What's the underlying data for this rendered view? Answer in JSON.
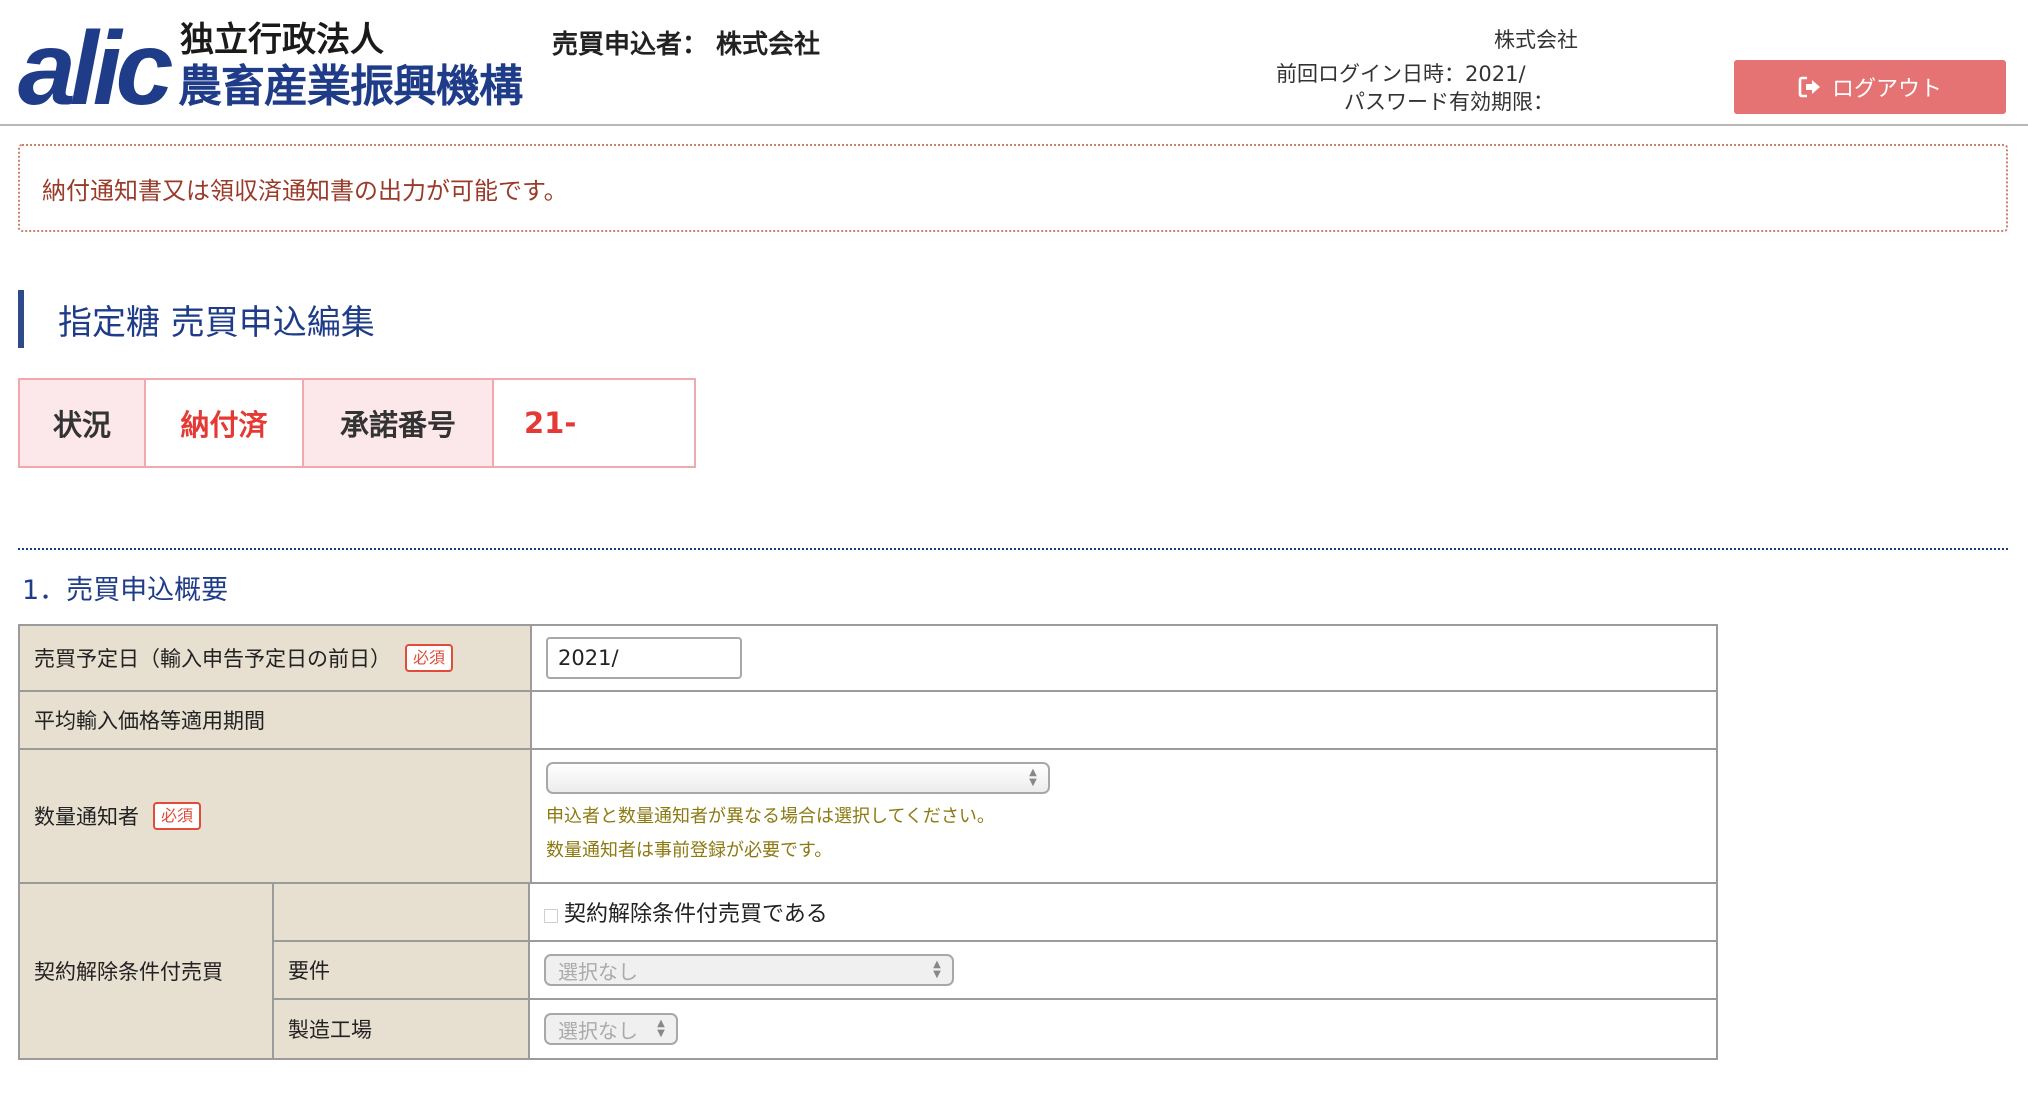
{
  "header": {
    "logo_mark": "alic",
    "logo_org_top": "独立行政法人",
    "logo_org_main": "農畜産業振興機構",
    "applicant_label": "売買申込者：",
    "applicant_value": "株式会社",
    "user_company": "株式会社",
    "last_login": "前回ログイン日時：2021/",
    "password_expiry": "パスワード有効期限：",
    "logout_label": "ログアウト",
    "logout_icon": "logout-icon",
    "logout_color": "#e57373"
  },
  "alert": {
    "message": "納付通知書又は領収済通知書の出力が可能です。"
  },
  "page_title": "指定糖 売買申込編集",
  "status": {
    "status_label": "状況",
    "status_value": "納付済",
    "approval_label": "承諾番号",
    "approval_value": "21-"
  },
  "section1": {
    "title": "1．売買申込概要",
    "rows": {
      "planned_date_label": "売買予定日（輸入申告予定日の前日）",
      "planned_date_value": "2021/",
      "avg_price_period_label": "平均輸入価格等適用期間",
      "notifier_label": "数量通知者",
      "notifier_value": "",
      "notifier_hint1": "申込者と数量通知者が異なる場合は選択してください。",
      "notifier_hint2": "数量通知者は事前登録が必要です。",
      "contract_label": "契約解除条件付売買",
      "contract_checkbox_label": "契約解除条件付売買である",
      "requirement_label": "要件",
      "requirement_value": "選択なし",
      "factory_label": "製造工場",
      "factory_value": "選択なし"
    },
    "required_badge": "必須"
  }
}
